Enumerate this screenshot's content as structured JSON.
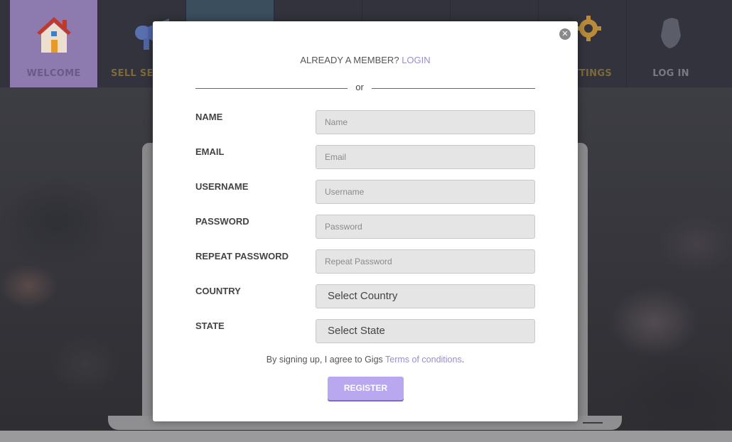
{
  "nav": {
    "items": [
      {
        "label": "WELCOME",
        "icon": "house-icon"
      },
      {
        "label": "SELL SER",
        "icon": "megaphone-icon"
      },
      {
        "label": "",
        "icon": "partial-icon"
      },
      {
        "label": "",
        "icon": ""
      },
      {
        "label": "",
        "icon": ""
      },
      {
        "label": "",
        "icon": ""
      },
      {
        "label": "TTINGS",
        "icon": "gear-icon"
      },
      {
        "label": "LOG IN",
        "icon": "hand-icon"
      }
    ]
  },
  "modal": {
    "member_prompt": "ALREADY A MEMBER?",
    "login_link": "LOGIN",
    "divider_text": "or",
    "close_icon": "close-icon",
    "fields": [
      {
        "label": "NAME",
        "placeholder": "Name"
      },
      {
        "label": "EMAIL",
        "placeholder": "Email"
      },
      {
        "label": "USERNAME",
        "placeholder": "Username"
      },
      {
        "label": "PASSWORD",
        "placeholder": "Password"
      },
      {
        "label": "REPEAT PASSWORD",
        "placeholder": "Repeat Password"
      }
    ],
    "country": {
      "label": "COUNTRY",
      "value": "Select Country"
    },
    "state": {
      "label": "STATE",
      "value": "Select State"
    },
    "terms_prefix": "By signing up, I agree to Gigs",
    "terms_link": "Terms of conditions",
    "terms_suffix": ".",
    "register_label": "REGISTER"
  },
  "colors": {
    "accent": "#9b8cd2",
    "register_button": "#b9a7ef",
    "nav_active": "#8d7bb0"
  }
}
